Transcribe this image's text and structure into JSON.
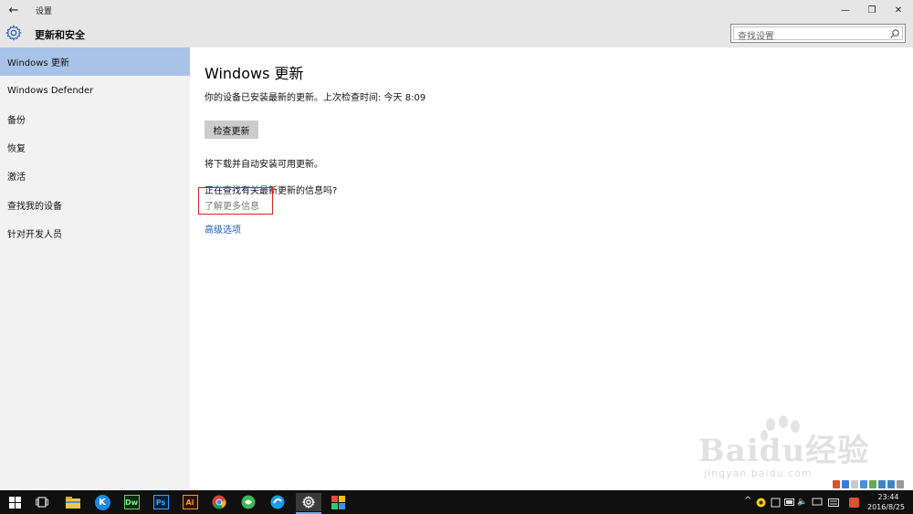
{
  "window": {
    "title": "设置",
    "back_glyph": "←",
    "minimize_glyph": "—",
    "maximize_glyph": "❐",
    "close_glyph": "✕"
  },
  "header": {
    "title": "更新和安全",
    "search_placeholder": "查找设置"
  },
  "sidebar": {
    "items": [
      {
        "label": "Windows 更新",
        "active": true
      },
      {
        "label": "Windows Defender"
      },
      {
        "label": "备份"
      },
      {
        "label": "恢复"
      },
      {
        "label": "激活"
      },
      {
        "label": "查找我的设备"
      },
      {
        "label": "针对开发人员"
      }
    ]
  },
  "main": {
    "title": "Windows 更新",
    "status": "你的设备已安装最新的更新。上次检查时间: 今天 8:09",
    "check_button": "检查更新",
    "auto_text": "将下载并自动安装可用更新。",
    "question": "正在查找有关最新更新的信息吗?",
    "learn_more": "了解更多信息",
    "advanced": "高级选项"
  },
  "watermark": {
    "brand": "Baidu经验",
    "url": "jingyan.baidu.com"
  },
  "taskbar": {
    "apps": [
      {
        "icon": "windows-start-icon"
      },
      {
        "icon": "task-view-icon"
      },
      {
        "icon": "file-explorer-icon"
      },
      {
        "icon": "k-app-icon",
        "text": "K"
      },
      {
        "icon": "dreamweaver-icon",
        "text": "Dw"
      },
      {
        "icon": "photoshop-icon",
        "text": "Ps"
      },
      {
        "icon": "illustrator-icon",
        "text": "Ai"
      },
      {
        "icon": "chrome-icon"
      },
      {
        "icon": "green-app-icon"
      },
      {
        "icon": "blue-browser-icon"
      },
      {
        "icon": "settings-icon"
      },
      {
        "icon": "colorful-app-icon"
      }
    ],
    "tray_chevron": "^",
    "tray_volume": "🔈",
    "time": "23:44",
    "date": "2016/8/25"
  },
  "colors": {
    "accent": "#a9c3e8",
    "link": "#1a5fb4",
    "highlight_box": "#e02020",
    "taskbar": "#101010"
  }
}
